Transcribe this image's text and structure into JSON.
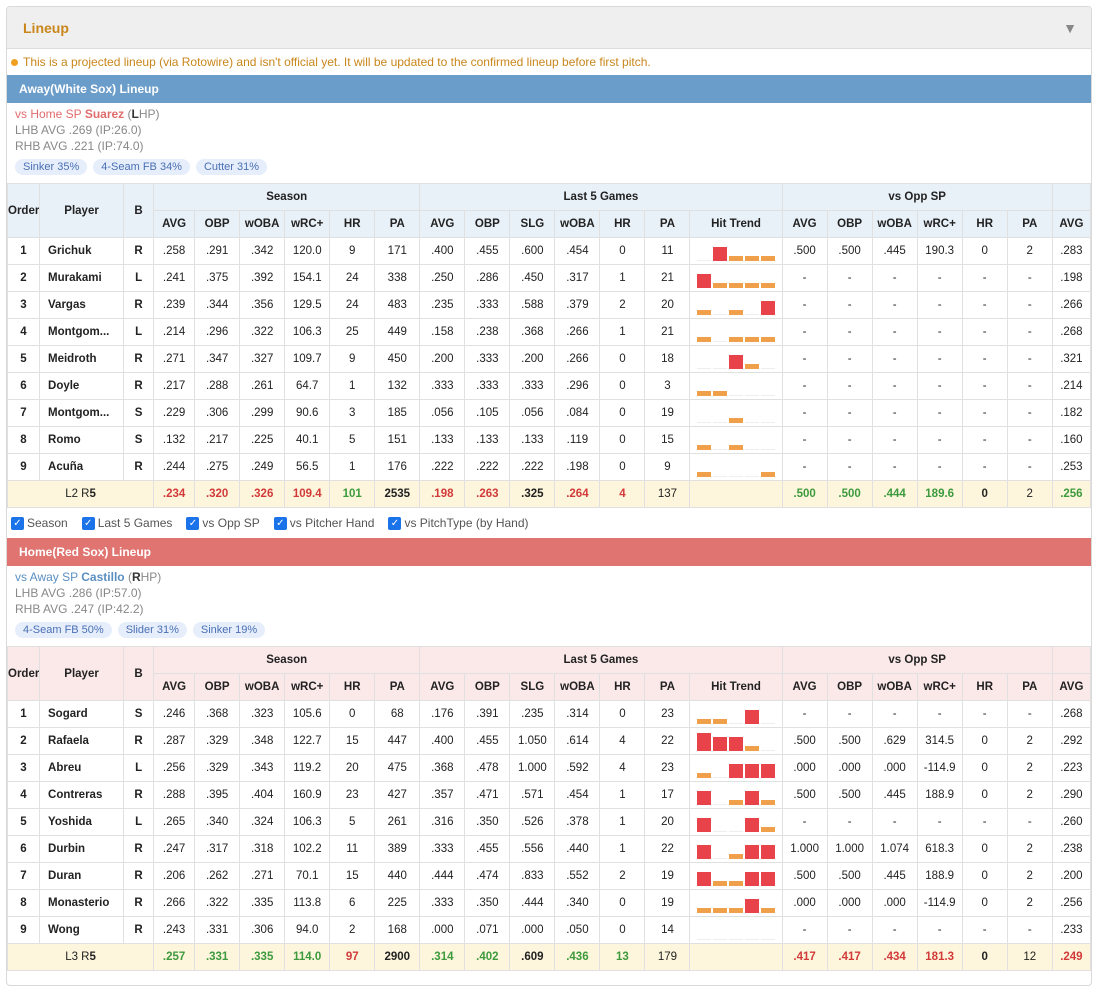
{
  "panel": {
    "title": "Lineup"
  },
  "notice": "This is a projected lineup (via Rotowire) and isn't official yet. It will be updated to the confirmed lineup before first pitch.",
  "headers": {
    "order": "Order",
    "player": "Player",
    "bats": "B",
    "groups": [
      "Season",
      "Last 5 Games",
      "vs Opp SP"
    ],
    "season": [
      "AVG",
      "OBP",
      "wOBA",
      "wRC+",
      "HR",
      "PA"
    ],
    "last5": [
      "AVG",
      "OBP",
      "SLG",
      "wOBA",
      "HR",
      "PA",
      "Hit Trend"
    ],
    "opp": [
      "AVG",
      "OBP",
      "wOBA",
      "wRC+",
      "HR",
      "PA"
    ],
    "extra": "AVG"
  },
  "away": {
    "title": "Away(White Sox) Lineup",
    "sp_prefix": "vs Home SP ",
    "sp_name": "Suarez",
    "sp_hand_open": " (",
    "sp_hand_letter": "L",
    "sp_hand_rest": "HP)",
    "lhb": "LHB AVG .269 (IP:26.0)",
    "rhb": "RHB AVG .221 (IP:74.0)",
    "pitches": [
      "Sinker 35%",
      "4-Seam FB 34%",
      "Cutter 31%"
    ],
    "rows": [
      {
        "order": "1",
        "name": "Grichuk",
        "b": "R",
        "s": [
          ".258",
          ".291",
          ".342",
          "120.0",
          "9",
          "171"
        ],
        "l": [
          ".400",
          ".455",
          ".600",
          ".454",
          "0",
          "11"
        ],
        "trend": [
          0,
          3,
          1,
          1,
          1
        ],
        "o": [
          ".500",
          ".500",
          ".445",
          "190.3",
          "0",
          "2"
        ],
        "x": ".283"
      },
      {
        "order": "2",
        "name": "Murakami",
        "b": "L",
        "s": [
          ".241",
          ".375",
          ".392",
          "154.1",
          "24",
          "338"
        ],
        "l": [
          ".250",
          ".286",
          ".450",
          ".317",
          "1",
          "21"
        ],
        "trend": [
          3,
          1,
          1,
          1,
          1
        ],
        "o": [
          "-",
          "-",
          "-",
          "-",
          "-",
          "-"
        ],
        "x": ".198"
      },
      {
        "order": "3",
        "name": "Vargas",
        "b": "R",
        "s": [
          ".239",
          ".344",
          ".356",
          "129.5",
          "24",
          "483"
        ],
        "l": [
          ".235",
          ".333",
          ".588",
          ".379",
          "2",
          "20"
        ],
        "trend": [
          1,
          0,
          1,
          0,
          3
        ],
        "o": [
          "-",
          "-",
          "-",
          "-",
          "-",
          "-"
        ],
        "x": ".266"
      },
      {
        "order": "4",
        "name": "Montgom...",
        "b": "L",
        "s": [
          ".214",
          ".296",
          ".322",
          "106.3",
          "25",
          "449"
        ],
        "l": [
          ".158",
          ".238",
          ".368",
          ".266",
          "1",
          "21"
        ],
        "trend": [
          1,
          0,
          1,
          1,
          1
        ],
        "o": [
          "-",
          "-",
          "-",
          "-",
          "-",
          "-"
        ],
        "x": ".268"
      },
      {
        "order": "5",
        "name": "Meidroth",
        "b": "R",
        "s": [
          ".271",
          ".347",
          ".327",
          "109.7",
          "9",
          "450"
        ],
        "l": [
          ".200",
          ".333",
          ".200",
          ".266",
          "0",
          "18"
        ],
        "trend": [
          0,
          0,
          3,
          1,
          0
        ],
        "o": [
          "-",
          "-",
          "-",
          "-",
          "-",
          "-"
        ],
        "x": ".321"
      },
      {
        "order": "6",
        "name": "Doyle",
        "b": "R",
        "s": [
          ".217",
          ".288",
          ".261",
          "64.7",
          "1",
          "132"
        ],
        "l": [
          ".333",
          ".333",
          ".333",
          ".296",
          "0",
          "3"
        ],
        "trend": [
          1,
          1,
          0,
          0,
          0
        ],
        "o": [
          "-",
          "-",
          "-",
          "-",
          "-",
          "-"
        ],
        "x": ".214"
      },
      {
        "order": "7",
        "name": "Montgom...",
        "b": "S",
        "s": [
          ".229",
          ".306",
          ".299",
          "90.6",
          "3",
          "185"
        ],
        "l": [
          ".056",
          ".105",
          ".056",
          ".084",
          "0",
          "19"
        ],
        "trend": [
          0,
          0,
          1,
          0,
          0
        ],
        "o": [
          "-",
          "-",
          "-",
          "-",
          "-",
          "-"
        ],
        "x": ".182"
      },
      {
        "order": "8",
        "name": "Romo",
        "b": "S",
        "s": [
          ".132",
          ".217",
          ".225",
          "40.1",
          "5",
          "151"
        ],
        "l": [
          ".133",
          ".133",
          ".133",
          ".119",
          "0",
          "15"
        ],
        "trend": [
          1,
          0,
          1,
          0,
          0
        ],
        "o": [
          "-",
          "-",
          "-",
          "-",
          "-",
          "-"
        ],
        "x": ".160"
      },
      {
        "order": "9",
        "name": "Acuña",
        "b": "R",
        "s": [
          ".244",
          ".275",
          ".249",
          "56.5",
          "1",
          "176"
        ],
        "l": [
          ".222",
          ".222",
          ".222",
          ".198",
          "0",
          "9"
        ],
        "trend": [
          1,
          0,
          0,
          0,
          1
        ],
        "o": [
          "-",
          "-",
          "-",
          "-",
          "-",
          "-"
        ],
        "x": ".253"
      }
    ],
    "total": {
      "label_prefix": "L2 R",
      "label_num": "5",
      "s": [
        ".234",
        ".320",
        ".326",
        "109.4",
        "101",
        "2535"
      ],
      "l": [
        ".198",
        ".263",
        ".325",
        ".264",
        "4",
        "137"
      ],
      "o": [
        ".500",
        ".500",
        ".444",
        "189.6",
        "0",
        "2"
      ],
      "x": ".256"
    }
  },
  "controls": [
    "Season",
    "Last 5 Games",
    "vs Opp SP",
    "vs Pitcher Hand",
    "vs PitchType (by Hand)"
  ],
  "home": {
    "title": "Home(Red Sox) Lineup",
    "sp_prefix": "vs Away SP ",
    "sp_name": "Castillo",
    "sp_hand_open": " (",
    "sp_hand_letter": "R",
    "sp_hand_rest": "HP)",
    "lhb": "LHB AVG .286 (IP:57.0)",
    "rhb": "RHB AVG .247 (IP:42.2)",
    "pitches": [
      "4-Seam FB 50%",
      "Slider 31%",
      "Sinker 19%"
    ],
    "rows": [
      {
        "order": "1",
        "name": "Sogard",
        "b": "S",
        "s": [
          ".246",
          ".368",
          ".323",
          "105.6",
          "0",
          "68"
        ],
        "l": [
          ".176",
          ".391",
          ".235",
          ".314",
          "0",
          "23"
        ],
        "trend": [
          1,
          1,
          0,
          3,
          0
        ],
        "o": [
          "-",
          "-",
          "-",
          "-",
          "-",
          "-"
        ],
        "x": ".268"
      },
      {
        "order": "2",
        "name": "Rafaela",
        "b": "R",
        "s": [
          ".287",
          ".329",
          ".348",
          "122.7",
          "15",
          "447"
        ],
        "l": [
          ".400",
          ".455",
          "1.050",
          ".614",
          "4",
          "22"
        ],
        "trend": [
          4,
          3,
          3,
          1,
          0
        ],
        "o": [
          ".500",
          ".500",
          ".629",
          "314.5",
          "0",
          "2"
        ],
        "x": ".292"
      },
      {
        "order": "3",
        "name": "Abreu",
        "b": "L",
        "s": [
          ".256",
          ".329",
          ".343",
          "119.2",
          "20",
          "475"
        ],
        "l": [
          ".368",
          ".478",
          "1.000",
          ".592",
          "4",
          "23"
        ],
        "trend": [
          1,
          0,
          3,
          3,
          3
        ],
        "o": [
          ".000",
          ".000",
          ".000",
          "-114.9",
          "0",
          "2"
        ],
        "x": ".223"
      },
      {
        "order": "4",
        "name": "Contreras",
        "b": "R",
        "s": [
          ".288",
          ".395",
          ".404",
          "160.9",
          "23",
          "427"
        ],
        "l": [
          ".357",
          ".471",
          ".571",
          ".454",
          "1",
          "17"
        ],
        "trend": [
          3,
          0,
          1,
          3,
          1
        ],
        "o": [
          ".500",
          ".500",
          ".445",
          "188.9",
          "0",
          "2"
        ],
        "x": ".290"
      },
      {
        "order": "5",
        "name": "Yoshida",
        "b": "L",
        "s": [
          ".265",
          ".340",
          ".324",
          "106.3",
          "5",
          "261"
        ],
        "l": [
          ".316",
          ".350",
          ".526",
          ".378",
          "1",
          "20"
        ],
        "trend": [
          3,
          0,
          0,
          3,
          1
        ],
        "o": [
          "-",
          "-",
          "-",
          "-",
          "-",
          "-"
        ],
        "x": ".260"
      },
      {
        "order": "6",
        "name": "Durbin",
        "b": "R",
        "s": [
          ".247",
          ".317",
          ".318",
          "102.2",
          "11",
          "389"
        ],
        "l": [
          ".333",
          ".455",
          ".556",
          ".440",
          "1",
          "22"
        ],
        "trend": [
          3,
          0,
          1,
          3,
          3
        ],
        "o": [
          "1.000",
          "1.000",
          "1.074",
          "618.3",
          "0",
          "2"
        ],
        "x": ".238"
      },
      {
        "order": "7",
        "name": "Duran",
        "b": "R",
        "s": [
          ".206",
          ".262",
          ".271",
          "70.1",
          "15",
          "440"
        ],
        "l": [
          ".444",
          ".474",
          ".833",
          ".552",
          "2",
          "19"
        ],
        "trend": [
          3,
          1,
          1,
          3,
          3
        ],
        "o": [
          ".500",
          ".500",
          ".445",
          "188.9",
          "0",
          "2"
        ],
        "x": ".200"
      },
      {
        "order": "8",
        "name": "Monasterio",
        "b": "R",
        "s": [
          ".266",
          ".322",
          ".335",
          "113.8",
          "6",
          "225"
        ],
        "l": [
          ".333",
          ".350",
          ".444",
          ".340",
          "0",
          "19"
        ],
        "trend": [
          1,
          1,
          1,
          3,
          1
        ],
        "o": [
          ".000",
          ".000",
          ".000",
          "-114.9",
          "0",
          "2"
        ],
        "x": ".256"
      },
      {
        "order": "9",
        "name": "Wong",
        "b": "R",
        "s": [
          ".243",
          ".331",
          ".306",
          "94.0",
          "2",
          "168"
        ],
        "l": [
          ".000",
          ".071",
          ".000",
          ".050",
          "0",
          "14"
        ],
        "trend": [
          0,
          0,
          0,
          0,
          0
        ],
        "o": [
          "-",
          "-",
          "-",
          "-",
          "-",
          "-"
        ],
        "x": ".233"
      }
    ],
    "total": {
      "label_prefix": "L3 R",
      "label_num": "5",
      "s": [
        ".257",
        ".331",
        ".335",
        "114.0",
        "97",
        "2900"
      ],
      "l": [
        ".314",
        ".402",
        ".609",
        ".436",
        "13",
        "179"
      ],
      "o": [
        ".417",
        ".417",
        ".434",
        "181.3",
        "0",
        "12"
      ],
      "x": ".249"
    }
  },
  "colors": {
    "orange": "#f0a04b",
    "red": "#e8434b",
    "away": "#6b9dca",
    "home": "#df7470",
    "accent": "#c9861a"
  }
}
